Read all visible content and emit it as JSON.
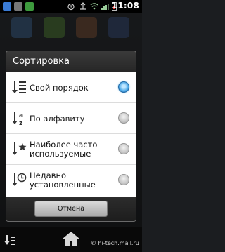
{
  "status_bar": {
    "time": "11:08",
    "battery_level": 0.4
  },
  "dialog": {
    "title": "Сортировка",
    "options": [
      {
        "label": "Свой порядок",
        "icon": "custom-order-icon",
        "selected": true
      },
      {
        "label": "По алфавиту",
        "icon": "alphabetical-sort-icon",
        "selected": false
      },
      {
        "label": "Наиболее часто используемые",
        "icon": "most-used-star-icon",
        "selected": false
      },
      {
        "label": "Недавно установленные",
        "icon": "recently-installed-clock-icon",
        "selected": false
      }
    ],
    "cancel_label": "Отмена"
  },
  "watermark": "© hi-tech.mail.ru",
  "colors": {
    "radio_selected": "#48a6e6",
    "dialog_title_bg": "#2f2f2f",
    "list_bg": "#ffffff"
  }
}
